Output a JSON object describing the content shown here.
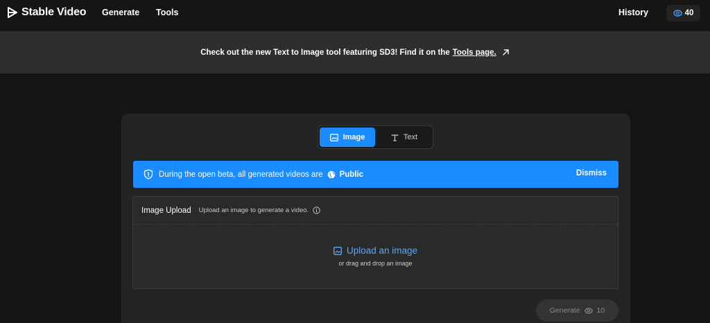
{
  "nav": {
    "brand": "Stable Video",
    "generate": "Generate",
    "tools": "Tools",
    "history": "History",
    "credits": "40"
  },
  "announcement": {
    "text": "Check out the new Text to Image tool featuring SD3! Find it on the",
    "link": "Tools page."
  },
  "mode_tabs": {
    "image": "Image",
    "text": "Text",
    "active": "Image"
  },
  "beta_notice": {
    "text": "During the open beta, all generated videos are",
    "visibility": "Public",
    "dismiss": "Dismiss"
  },
  "upload": {
    "title": "Image Upload",
    "description": "Upload an image to generate a video.",
    "cta": "Upload an image",
    "hint": "or drag and drop an image"
  },
  "generate_button": {
    "label": "Generate",
    "cost": "10"
  },
  "colors": {
    "accent": "#1a8cff",
    "background": "#151515",
    "banner": "#2e2e2e",
    "card": "#242424",
    "link": "#59a8ff"
  },
  "icons": [
    "stable-video-logo-icon",
    "credits-icon",
    "external-arrow-icon",
    "image-icon",
    "text-icon",
    "shield-icon",
    "globe-icon",
    "info-icon"
  ]
}
